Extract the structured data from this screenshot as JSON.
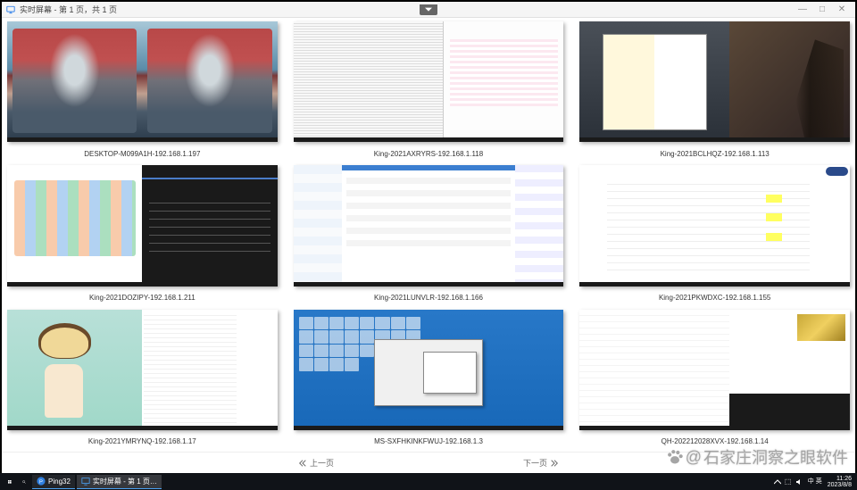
{
  "window": {
    "title": "实时屏幕 - 第 1 页，共 1 页",
    "dropdown_hint": "展开"
  },
  "window_controls": {
    "minimize": "—",
    "maximize": "□",
    "close": "✕"
  },
  "screens": [
    {
      "caption": "DESKTOP-M099A1H-192.168.1.197"
    },
    {
      "caption": "King-2021AXRYRS-192.168.1.118"
    },
    {
      "caption": "King-2021BCLHQZ-192.168.1.113"
    },
    {
      "caption": "King-2021DOZIPY-192.168.1.211"
    },
    {
      "caption": "King-2021LUNVLR-192.168.1.166"
    },
    {
      "caption": "King-2021PKWDXC-192.168.1.155"
    },
    {
      "caption": "King-2021YMRYNQ-192.168.1.17"
    },
    {
      "caption": "MS-SXFHKINKFWUJ-192.168.1.3"
    },
    {
      "caption": "QH-202212028XVX-192.168.1.14"
    }
  ],
  "pager": {
    "prev": "上一页",
    "next": "下一页"
  },
  "watermark": {
    "at": "@",
    "text": "石家庄洞察之眼软件"
  },
  "taskbar": {
    "app1": {
      "label": "Ping32"
    },
    "app2": {
      "label": "实时屏幕 - 第 1 页…"
    },
    "ime": "中 英",
    "time": "11:26",
    "date": "2023/8/8"
  }
}
